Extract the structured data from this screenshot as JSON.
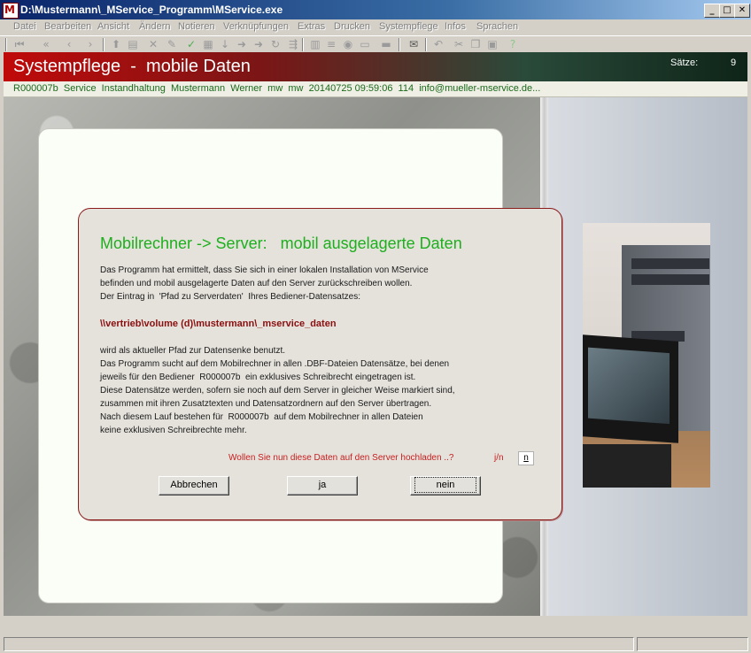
{
  "window": {
    "title": "D:\\Mustermann\\_MService_Programm\\MService.exe",
    "app_icon_letter": "M",
    "min_glyph": "_",
    "max_glyph": "□",
    "close_glyph": "✕"
  },
  "menu": [
    "Datei",
    "Bearbeiten",
    "Ansicht",
    "Ändern",
    "Notieren",
    "Verknüpfungen",
    "Extras",
    "Drucken",
    "Systempflege",
    "Infos",
    "Sprachen"
  ],
  "toolbar_icons": [
    "first-record-icon",
    "prev-page-icon",
    "prev-record-icon",
    "next-record-icon",
    "export-icon",
    "import-icon",
    "delete-icon",
    "edit-icon",
    "confirm-icon",
    "form-icon",
    "download-icon",
    "forward-icon",
    "forward-all-icon",
    "refresh-icon",
    "branch-icon",
    "building-icon",
    "list-icon",
    "view-icon",
    "folder-icon",
    "print-icon",
    "mail-icon",
    "undo-icon",
    "cut-icon",
    "copy-icon",
    "paste-icon",
    "help-icon"
  ],
  "header": {
    "title": "Systempflege  -  mobile Daten",
    "records_label": "Sätze:",
    "records_count": "9"
  },
  "record_info": "R000007b  Service  Instandhaltung  Mustermann  Werner  mw  mw  20140725 09:59:06  114  info@mueller-mservice.de...",
  "dialog": {
    "title": "Mobilrechner -> Server:   mobil ausgelagerte Daten",
    "para1": [
      "Das Programm hat ermittelt, dass Sie sich in einer lokalen Installation von MService",
      "befinden und mobil ausgelagerte Daten auf den Server zurückschreiben wollen.",
      "Der Eintrag in  'Pfad zu Serverdaten'  Ihres Bediener-Datensatzes:"
    ],
    "path": "\\\\vertrieb\\volume (d)\\mustermann\\_mservice_daten",
    "para2": [
      "wird als aktueller Pfad zur Datensenke benutzt.",
      "Das Programm sucht auf dem Mobilrechner in allen .DBF-Dateien Datensätze, bei denen",
      "jeweils für den Bediener  R000007b  ein exklusives Schreibrecht eingetragen ist.",
      "Diese Datensätze werden, sofern sie noch auf dem Server in gleicher Weise markiert sind,",
      "zusammen mit ihren Zusatztexten und Datensatzordnern auf den Server übertragen.",
      "Nach diesem Lauf bestehen für  R000007b  auf dem Mobilrechner in allen Dateien",
      "keine exklusiven Schreibrechte mehr."
    ],
    "question": "Wollen Sie nun diese Daten auf den Server hochladen ..?",
    "yn_hint": "j/n",
    "answer_value": "n",
    "buttons": {
      "cancel": "Abbrechen",
      "yes": "ja",
      "no": "nein"
    }
  }
}
